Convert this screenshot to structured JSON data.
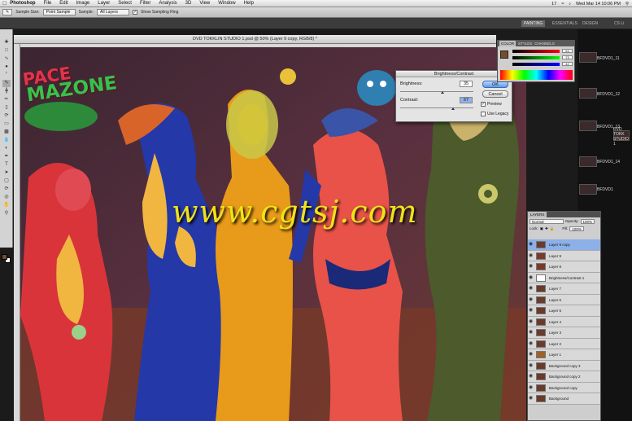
{
  "menubar": {
    "app_name": "Photoshop",
    "items": [
      "File",
      "Edit",
      "Image",
      "Layer",
      "Select",
      "Filter",
      "Analysis",
      "3D",
      "View",
      "Window",
      "Help"
    ],
    "status_num": "17",
    "clock": "Wed Mar 14  10:06 PM"
  },
  "options_bar": {
    "sample_size_label": "Sample Size:",
    "sample_size_value": "Point Sample",
    "sample_label": "Sample:",
    "sample_value": "All Layers",
    "show_ring_label": "Show Sampling Ring"
  },
  "app_bar": {
    "workspaces": [
      "PAINTING",
      "ESSENTIALS",
      "DESIGN"
    ],
    "active": "PAINTING",
    "cs_live": "CS Li"
  },
  "document": {
    "title": "DVD TOKKLIN STUDIO 1.psd @ 50% (Layer 9 copy, RGB/8) *"
  },
  "canvas": {
    "logo_line1": "PACE",
    "logo_line2": "MAZONE",
    "watermark": "www.cgtsj.com"
  },
  "brightness_dialog": {
    "title": "Brightness/Contrast",
    "brightness_label": "Brightness:",
    "brightness_value": "35",
    "contrast_label": "Contrast:",
    "contrast_value": "67",
    "brightness_level_pct": 58,
    "contrast_level_pct": 72,
    "ok": "OK",
    "cancel": "Cancel",
    "preview_label": "Preview",
    "preview_checked": true,
    "legacy_label": "Use Legacy",
    "legacy_checked": false
  },
  "color_panel": {
    "tabs": [
      "COLOR",
      "STYLES",
      "CHANNELS"
    ],
    "values": [
      "64",
      "73",
      "42"
    ],
    "fg_color": "#7a4a2a"
  },
  "layers_panel": {
    "tab": "LAYERS",
    "blend_mode": "Normal",
    "opacity_label": "Opacity:",
    "opacity_value": "100%",
    "fill_label": "Fill:",
    "fill_value": "100%",
    "lock_label": "Lock:",
    "layers": [
      "Layer 9 copy",
      "Layer 9",
      "Layer 8",
      "Brightness/Contrast 1",
      "Layer 7",
      "Layer 6",
      "Layer 5",
      "Layer 4",
      "Layer 3",
      "Layer 2",
      "Layer 1",
      "Background copy 3",
      "Background copy 2",
      "Background copy",
      "Background"
    ],
    "selected_index": 0
  },
  "desktop": {
    "items": [
      "BFDVD1_11",
      "BFDVD1_12",
      "BFDVD1_13",
      "DVD TOKK STUDIO 1",
      "BFDVD1_14",
      "BFDVD1"
    ]
  }
}
